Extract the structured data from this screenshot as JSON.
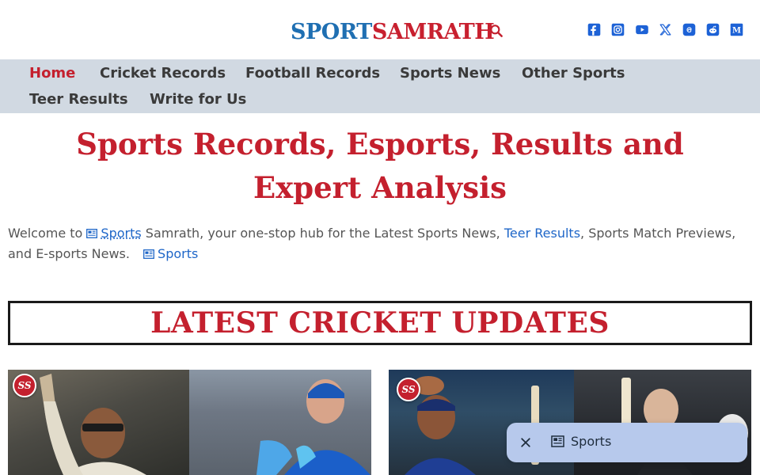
{
  "brand": {
    "logo_part1": "SPORT",
    "logo_part2": "SAMRATH"
  },
  "header": {
    "search_icon": "search-icon",
    "social": [
      {
        "name": "facebook-icon",
        "color": "#1877f2"
      },
      {
        "name": "instagram-icon",
        "color": "#2f6fd6"
      },
      {
        "name": "youtube-icon",
        "color": "#1d62d6"
      },
      {
        "name": "x-icon",
        "color": "#1d62d6"
      },
      {
        "name": "threads-icon",
        "color": "#1d62d6"
      },
      {
        "name": "reddit-icon",
        "color": "#1d62d6"
      },
      {
        "name": "medium-icon",
        "color": "#1d62d6"
      }
    ]
  },
  "nav": {
    "items": [
      {
        "label": "Home",
        "active": true
      },
      {
        "label": "Cricket Records"
      },
      {
        "label": "Football Records"
      },
      {
        "label": "Sports News"
      },
      {
        "label": "Other Sports"
      },
      {
        "label": "Teer Results"
      },
      {
        "label": "Write for Us"
      }
    ]
  },
  "hero": {
    "title": "Sports Records, Esports, Results and Expert Analysis"
  },
  "intro": {
    "t1": "Welcome to ",
    "link_sports": "Sports",
    "t2": " Samrath, your one-stop hub for the Latest Sports News, ",
    "link_teer": "Teer Results",
    "t3": ", Sports Match Previews, and E-sports News.",
    "link_sports2": "Sports"
  },
  "section": {
    "heading": "LATEST CRICKET UPDATES"
  },
  "cards": {
    "badge_text": "SS"
  },
  "popup": {
    "close_icon": "close-icon",
    "link_label": "Sports"
  },
  "colors": {
    "accent_red": "#c4202e",
    "link_blue": "#1e66c8",
    "nav_bg": "#d1d9e2",
    "popup_bg": "#b7c9ec"
  }
}
